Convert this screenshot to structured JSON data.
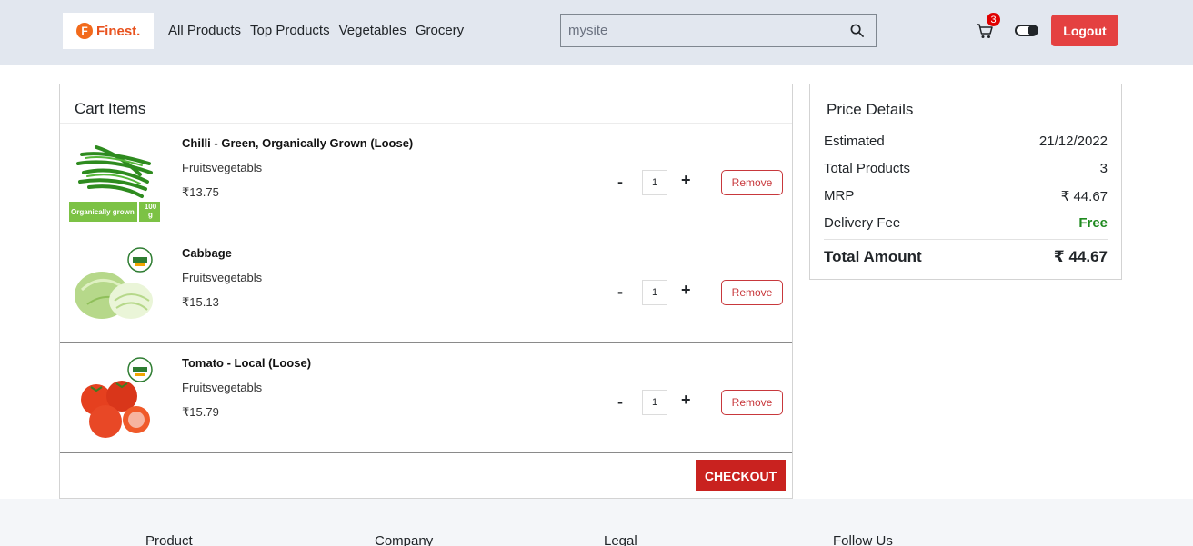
{
  "header": {
    "logo_letter": "F",
    "logo_text": "Finest.",
    "nav": [
      "All Products",
      "Top Products",
      "Vegetables",
      "Grocery"
    ],
    "search": {
      "placeholder": "mysite",
      "value": ""
    },
    "cart_count": "3",
    "logout_label": "Logout"
  },
  "cart": {
    "title": "Cart Items",
    "items": [
      {
        "name": "Chilli - Green, Organically Grown (Loose)",
        "category": "Fruitsvegetabls",
        "price": "₹13.75",
        "qty": "1",
        "remove_label": "Remove",
        "badge_text": "Organically grown",
        "badge_qty": "100 g"
      },
      {
        "name": "Cabbage",
        "category": "Fruitsvegetabls",
        "price": "₹15.13",
        "qty": "1",
        "remove_label": "Remove"
      },
      {
        "name": "Tomato - Local (Loose)",
        "category": "Fruitsvegetabls",
        "price": "₹15.79",
        "qty": "1",
        "remove_label": "Remove"
      }
    ],
    "minus_label": "-",
    "plus_label": "+",
    "checkout_label": "CHECKOUT"
  },
  "price_details": {
    "title": "Price Details",
    "rows": [
      {
        "label": "Estimated",
        "value": "21/12/2022"
      },
      {
        "label": "Total Products",
        "value": "3"
      },
      {
        "label": "MRP",
        "value": "₹ 44.67"
      },
      {
        "label": "Delivery Fee",
        "value": "Free"
      }
    ],
    "total_label": "Total Amount",
    "total_value": "₹ 44.67"
  },
  "footer": {
    "headings": [
      "Product",
      "Company",
      "Legal",
      "Follow Us"
    ]
  },
  "colors": {
    "header_bg": "#e2e7ef",
    "logout_red": "#e44141",
    "checkout_red": "#c9221f",
    "free_green": "#1f8a1f"
  }
}
